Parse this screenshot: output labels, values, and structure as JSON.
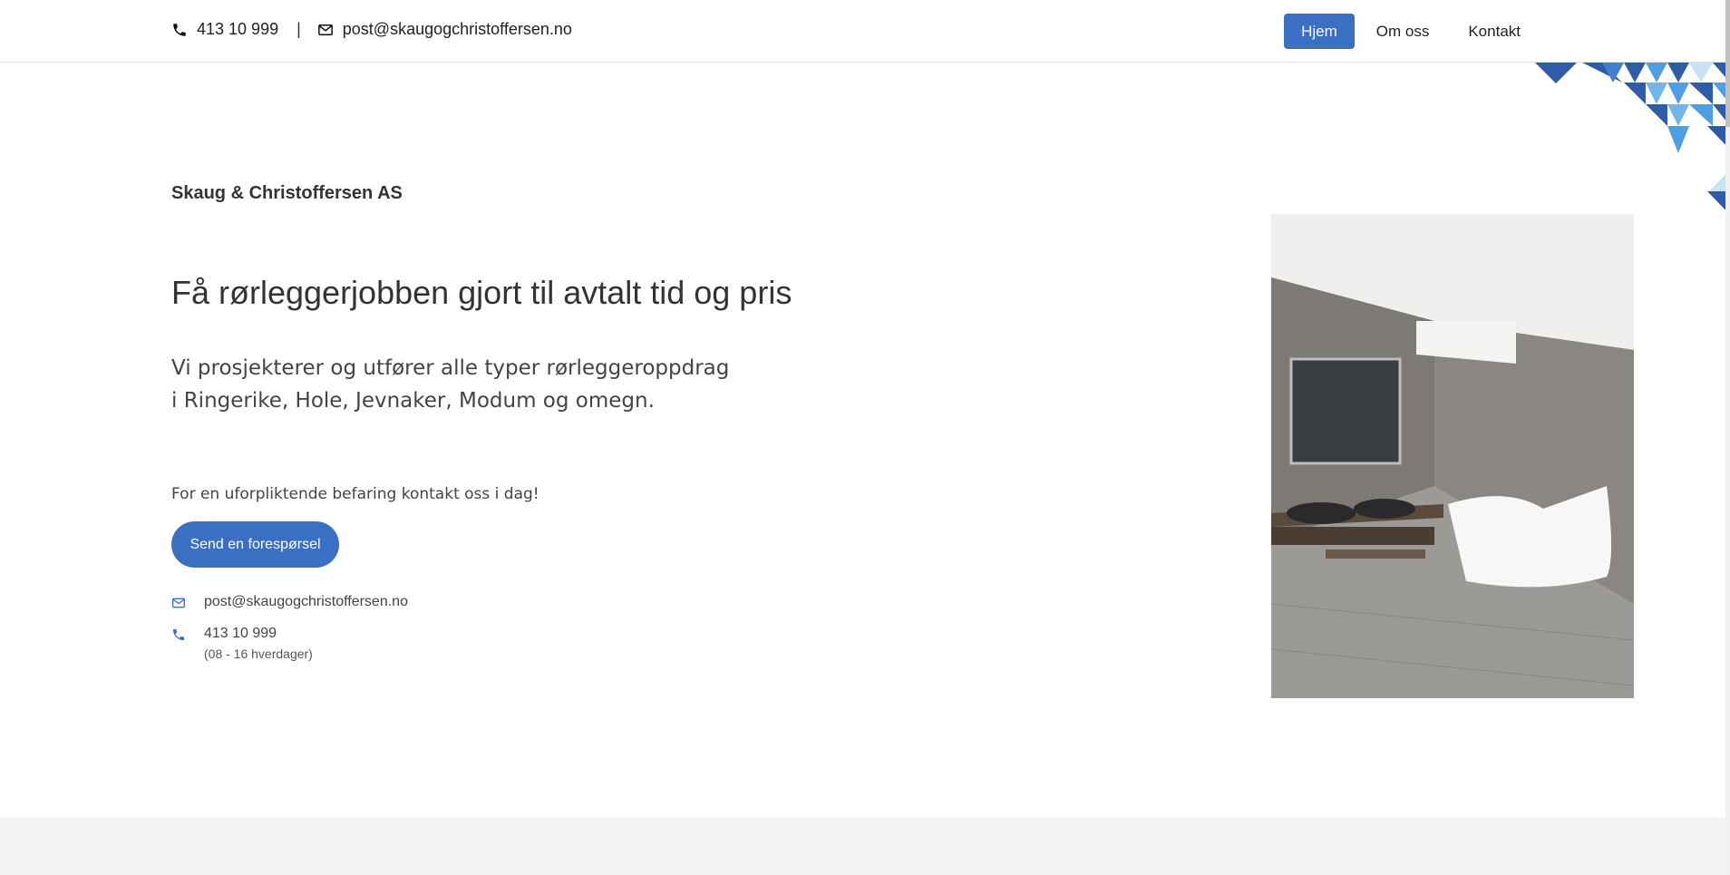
{
  "header": {
    "phone": "413 10 999",
    "separator": "|",
    "email": "post@skaugogchristoffersen.no",
    "nav": [
      {
        "label": "Hjem",
        "active": true
      },
      {
        "label": "Om oss",
        "active": false
      },
      {
        "label": "Kontakt",
        "active": false
      }
    ]
  },
  "hero": {
    "company": "Skaug & Christoffersen AS",
    "headline": "Få rørleggerjobben gjort til avtalt tid og pris",
    "lead_line1": "Vi prosjekterer og utfører alle typer rørleggeroppdrag",
    "lead_line2": "i Ringerike, Hole, Jevnaker, Modum og omegn.",
    "cta_text": "For en uforpliktende befaring kontakt oss i dag!",
    "cta_button": "Send en forespørsel",
    "email": "post@skaugogchristoffersen.no",
    "phone": "413 10 999",
    "hours": "(08 - 16 hverdager)"
  },
  "icons": {
    "phone": "phone-icon",
    "email": "envelope-icon"
  },
  "colors": {
    "accent": "#3a6fc4",
    "footer_band": "#f4f4f4"
  }
}
